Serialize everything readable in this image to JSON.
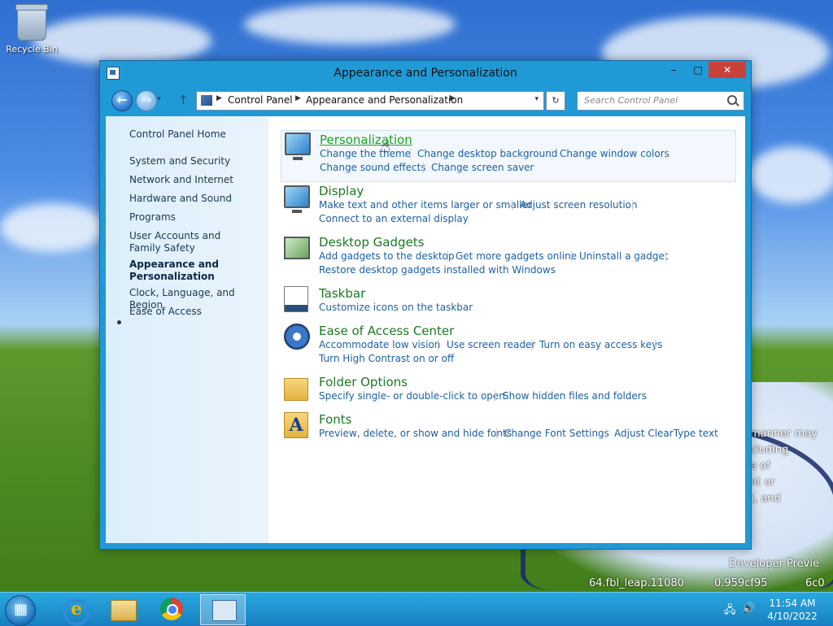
{
  "desktop": {
    "recycle_bin_label": "Recycle Bin",
    "watermark_lines": [
      "manner may",
      "cluding",
      "e of",
      "nt or",
      "), and",
      "Developer Previe",
      "64.fbl_leap.11080",
      "0.959cf95",
      "6c0"
    ]
  },
  "window": {
    "title": "Appearance and Personalization",
    "min_glyph": "–",
    "max_glyph": "□",
    "close_glyph": "✕",
    "nav": {
      "back_glyph": "←",
      "forward_glyph": "→",
      "dropdown_glyph": "▾",
      "up_glyph": "↑",
      "breadcrumb": [
        "Control Panel",
        "Appearance and Personalization"
      ],
      "crumb_sep": "▶",
      "address_dropdown_glyph": "▾",
      "refresh_glyph": "↻",
      "search_placeholder": "Search Control Panel"
    },
    "sidebar": {
      "home": "Control Panel Home",
      "items": [
        "System and Security",
        "Network and Internet",
        "Hardware and Sound",
        "Programs",
        "User Accounts and Family Safety",
        "Appearance and Personalization",
        "Clock, Language, and Region",
        "Ease of Access"
      ],
      "active_index": 5
    },
    "categories": [
      {
        "title": "Personalization",
        "icon": "monitor-icon",
        "links": [
          "Change the theme",
          "Change desktop background",
          "Change window colors",
          "Change sound effects",
          "Change screen saver"
        ]
      },
      {
        "title": "Display",
        "icon": "monitor-icon",
        "links": [
          "Make text and other items larger or smaller",
          "Adjust screen resolution",
          "Connect to an external display"
        ]
      },
      {
        "title": "Desktop Gadgets",
        "icon": "gadget-icon",
        "links": [
          "Add gadgets to the desktop",
          "Get more gadgets online",
          "Uninstall a gadget",
          "Restore desktop gadgets installed with Windows"
        ]
      },
      {
        "title": "Taskbar",
        "icon": "taskbar-icon",
        "links": [
          "Customize icons on the taskbar"
        ]
      },
      {
        "title": "Ease of Access Center",
        "icon": "ease-of-access-icon",
        "links": [
          "Accommodate low vision",
          "Use screen reader",
          "Turn on easy access keys",
          "Turn High Contrast on or off"
        ]
      },
      {
        "title": "Folder Options",
        "icon": "folder-icon",
        "links": [
          "Specify single- or double-click to open",
          "Show hidden files and folders"
        ]
      },
      {
        "title": "Fonts",
        "icon": "font-icon",
        "links": [
          "Preview, delete, or show and hide fonts",
          "Change Font Settings",
          "Adjust ClearType text"
        ]
      }
    ],
    "font_icon_letter": "A",
    "cursor_glyph": "☝"
  },
  "taskbar": {
    "ie_letter": "e",
    "tray": {
      "network_glyph": "🖧",
      "volume_glyph": "🔊"
    },
    "clock": {
      "time": "11:54 AM",
      "date": "4/10/2022"
    }
  },
  "colors": {
    "window_frame": "#1f9ad6",
    "category_title": "#1b7a22",
    "link": "#1c5fa7",
    "close_button": "#c9423a"
  }
}
